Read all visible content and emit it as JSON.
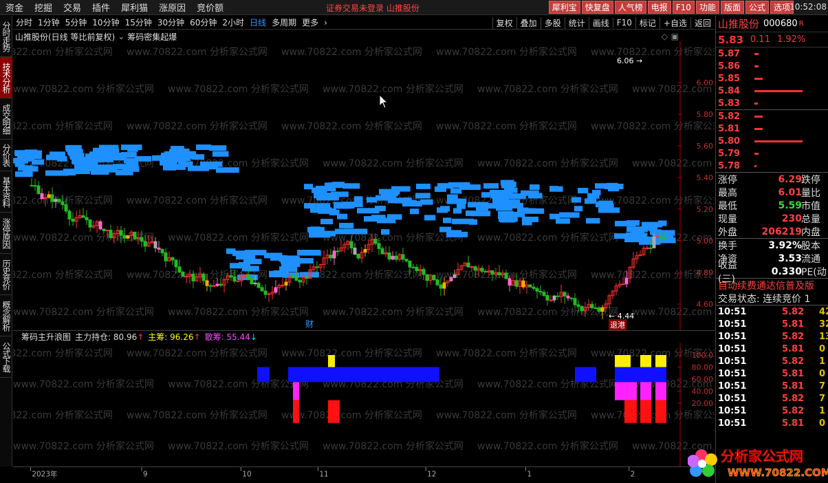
{
  "menubar": {
    "items": [
      "资金",
      "挖掘",
      "交易",
      "插件",
      "犀利猫",
      "涨原因",
      "竞价额"
    ],
    "notice": "证券交易未登录  山推股份",
    "buttons": [
      "犀利宝",
      "快复盘",
      "人气榜",
      "电报",
      "F10",
      "功能",
      "版面",
      "公式",
      "选项"
    ],
    "clock": "10:52:08"
  },
  "leftbar": {
    "tabs": [
      "分时走势",
      "技术分析",
      "成交明细",
      "分价表",
      "基本资料",
      "涨停原因",
      "历史竞价",
      "概念解析",
      "公式下载"
    ],
    "active": 1
  },
  "periods": {
    "items": [
      "分时",
      "1分钟",
      "5分钟",
      "10分钟",
      "15分钟",
      "30分钟",
      "60分钟",
      "2小时",
      "日线",
      "多周期",
      "更多"
    ],
    "active": "日线"
  },
  "rtools": [
    "复权",
    "叠加",
    "多股",
    "统计",
    "画线",
    "F10",
    "标记",
    "+自选",
    "返回"
  ],
  "chart_header": {
    "title": "山推股份(日线 等比前复权)",
    "indicator": "筹码密集起爆"
  },
  "main_chart": {
    "yticks": [
      "6.00",
      "5.80",
      "5.60",
      "5.40",
      "5.20",
      "5.00",
      "4.80",
      "4.60"
    ],
    "high_label": "6.06",
    "low_label": "4.44",
    "tag_cai": "财",
    "tag_tuigang": "退港"
  },
  "indicator": {
    "name": "筹码主升浪图",
    "l1": "主力持仓: 80.96",
    "l2": "主筹: 96.26",
    "l3": "散筹: 55.44"
  },
  "sub_chart": {
    "yticks": [
      "100.0",
      "80.00",
      "60.00",
      "40.00",
      "20.00"
    ]
  },
  "x_axis": {
    "labels": [
      "2023年",
      "9",
      "10",
      "11",
      "12",
      "1",
      "2"
    ]
  },
  "watermark": "www.70822.com 分析家公式网",
  "stock": {
    "name": "山推股份",
    "code": "000680",
    "flag": "R",
    "price": "5.83",
    "change": "0.11",
    "pct": "1.92%"
  },
  "orderbook": {
    "asks": [
      {
        "p": "5.87",
        "w": 6
      },
      {
        "p": "5.86",
        "w": 6
      },
      {
        "p": "5.85",
        "w": 12
      },
      {
        "p": "5.84",
        "w": 70
      },
      {
        "p": "5.83",
        "w": 5
      }
    ],
    "bids": [
      {
        "p": "5.82",
        "w": 12
      },
      {
        "p": "5.81",
        "w": 12
      },
      {
        "p": "5.80",
        "w": 70
      },
      {
        "p": "5.79",
        "w": 6
      },
      {
        "p": "5.78",
        "w": 3
      }
    ]
  },
  "quotes": [
    {
      "k": "涨停",
      "v": "6.29",
      "k2": "跌停",
      "c": "#ff4040"
    },
    {
      "k": "最高",
      "v": "6.01",
      "k2": "量比",
      "c": "#ff4040"
    },
    {
      "k": "最低",
      "v": "5.59",
      "k2": "市值",
      "c": "#33dd33"
    },
    {
      "k": "现量",
      "v": "230",
      "k2": "总量",
      "c": "#ff4040"
    },
    {
      "k": "外盘",
      "v": "206219",
      "k2": "内盘",
      "c": "#ff4040"
    }
  ],
  "quotes2": [
    {
      "k": "换手",
      "v": "3.92%",
      "k2": "股本",
      "c": "#fff"
    },
    {
      "k": "净资",
      "v": "3.53",
      "k2": "流通",
      "c": "#fff"
    },
    {
      "k": "收益(三)",
      "v": "0.330",
      "k2": "PE(动",
      "c": "#fff"
    }
  ],
  "scroll_text": [
    "自动续费通达信普及版",
    "交易状态: 连续竞价 1"
  ],
  "ticks": [
    {
      "t": "10:51",
      "p": "5.82",
      "v": "42"
    },
    {
      "t": "10:51",
      "p": "5.81",
      "v": "32"
    },
    {
      "t": "10:51",
      "p": "5.82",
      "v": "13"
    },
    {
      "t": "10:51",
      "p": "5.81",
      "v": "0"
    },
    {
      "t": "10:51",
      "p": "5.82",
      "v": "1"
    },
    {
      "t": "10:51",
      "p": "5.81",
      "v": "0"
    },
    {
      "t": "10:51",
      "p": "5.81",
      "v": "7"
    },
    {
      "t": "10:51",
      "p": "5.82",
      "v": "7"
    },
    {
      "t": "10:51",
      "p": "5.82",
      "v": "1"
    },
    {
      "t": "10:51",
      "p": "5.81",
      "v": "0"
    }
  ],
  "logo": {
    "cn": "分析家公式网",
    "url": "WWW.70822.COM"
  }
}
